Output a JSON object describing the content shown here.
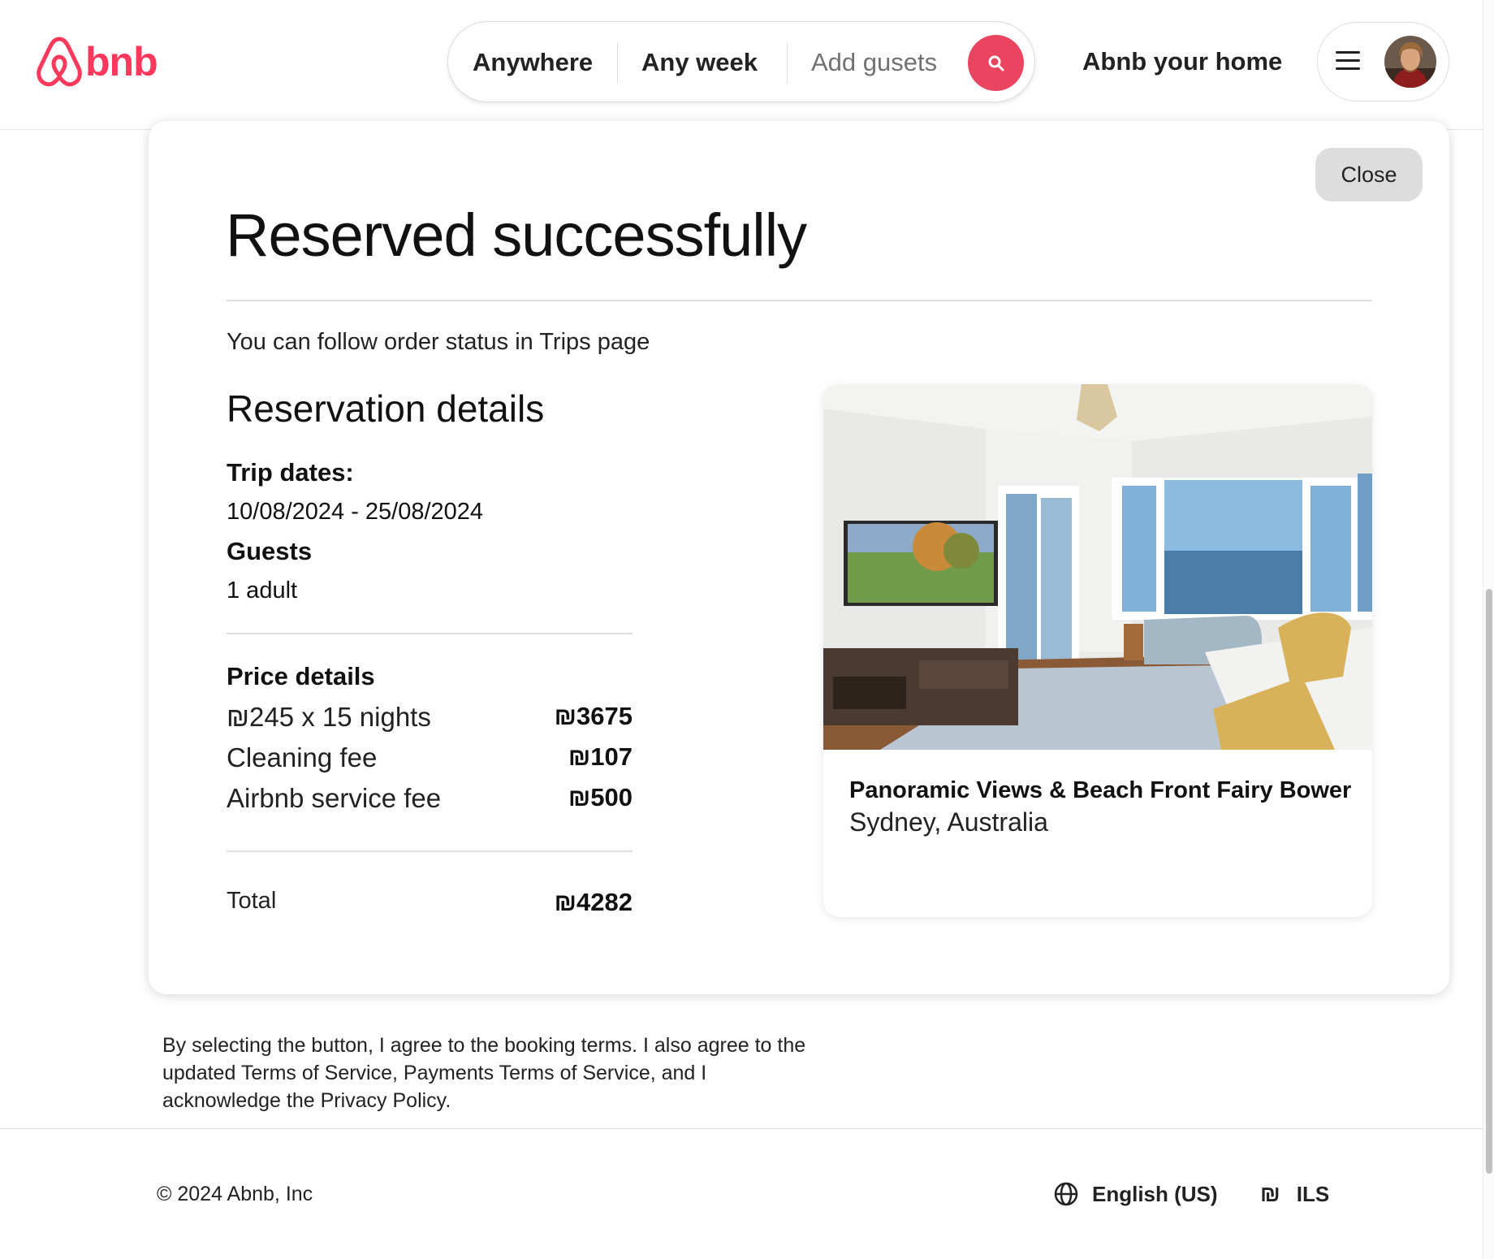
{
  "header": {
    "logo_text": "bnb",
    "search": {
      "where_label": "Anywhere",
      "when_label": "Any week",
      "guests_placeholder": "Add gusets",
      "search_icon": "search-icon"
    },
    "host_link": "Abnb your home",
    "menu_icon": "hamburger-icon"
  },
  "modal": {
    "close_label": "Close",
    "title": "Reserved successfully",
    "status_note": "You can follow order status in Trips page",
    "reservation": {
      "heading": "Reservation details",
      "trip_dates_label": "Trip dates:",
      "trip_dates_value": "10/08/2024 - 25/08/2024",
      "guests_label": "Guests",
      "guests_value": "1 adult"
    },
    "price": {
      "heading": "Price details",
      "items": [
        {
          "label": "₪245 x 15 nights",
          "value": "₪3675"
        },
        {
          "label": "Cleaning fee",
          "value": "₪107"
        },
        {
          "label": "Airbnb service fee",
          "value": "₪500"
        }
      ],
      "total_label": "Total",
      "total_value": "₪4282"
    },
    "listing": {
      "title": "Panoramic Views & Beach Front Fairy Bower",
      "location": "Sydney, Australia"
    }
  },
  "terms": "By selecting the button, I agree to the booking terms. I also agree to the updated Terms of Service, Payments Terms of Service, and I acknowledge the Privacy Policy.",
  "footer": {
    "copyright": "© 2024 Abnb, Inc",
    "language": "English (US)",
    "currency_symbol": "₪",
    "currency": "ILS"
  },
  "colors": {
    "brand": "#ff385c",
    "search_button": "#e94560",
    "close_button_bg": "#dddddd",
    "divider": "#dddddd"
  }
}
